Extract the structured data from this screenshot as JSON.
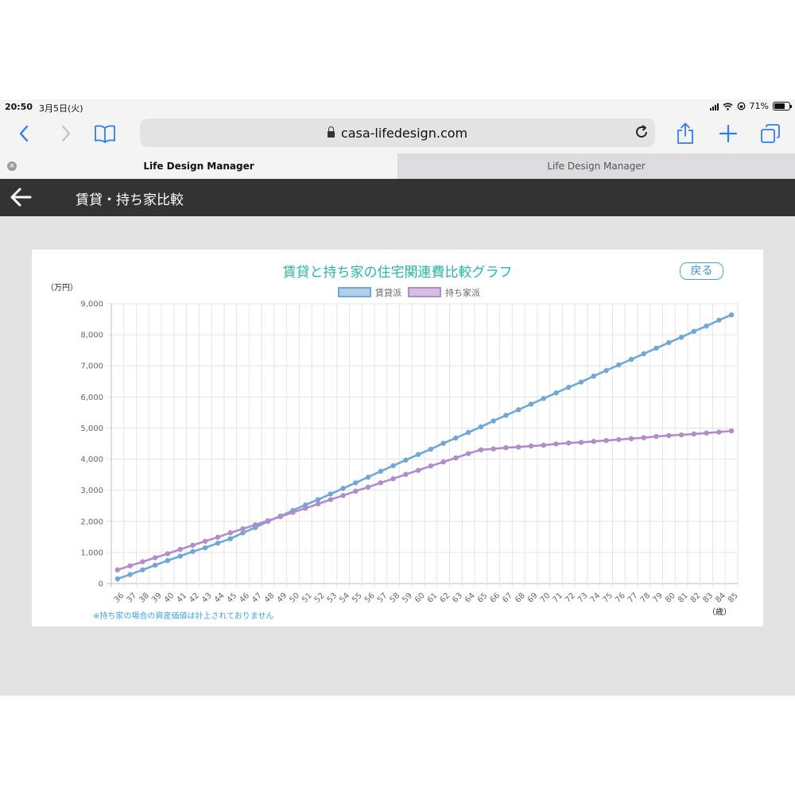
{
  "statusbar": {
    "time": "20:50",
    "date": "3月5日(火)",
    "battery": "71%",
    "battery_level": 0.71
  },
  "browser": {
    "url": "casa-lifedesign.com",
    "tabs": [
      {
        "label": "Life Design Manager"
      },
      {
        "label": "Life Design Manager"
      }
    ]
  },
  "appbar": {
    "title": "賃貸・持ち家比較"
  },
  "card": {
    "back_button": "戻る",
    "note": "※持ち家の場合の資産価値は計上されておりません",
    "y_unit": "（万円）",
    "x_unit": "（歳）"
  },
  "colors": {
    "rent": "#6fa8d6",
    "own": "#b08cc8",
    "title": "#26b6a8",
    "appbar": "#333333"
  },
  "chart_data": {
    "type": "line",
    "title": "賃貸と持ち家の住宅関連費比較グラフ",
    "xlabel": "（歳）",
    "ylabel": "（万円）",
    "ylim": [
      0,
      9000
    ],
    "grid": true,
    "legend": "top-center",
    "x": [
      "36",
      "37",
      "38",
      "39",
      "40",
      "41",
      "42",
      "43",
      "44",
      "45",
      "46",
      "47",
      "48",
      "49",
      "50",
      "51",
      "52",
      "53",
      "54",
      "55",
      "56",
      "57",
      "58",
      "59",
      "60",
      "61",
      "62",
      "63",
      "64",
      "65",
      "66",
      "67",
      "68",
      "69",
      "70",
      "71",
      "72",
      "73",
      "74",
      "75",
      "76",
      "77",
      "78",
      "79",
      "80",
      "81",
      "82",
      "83",
      "84",
      "85"
    ],
    "y_ticks": [
      "0",
      "1,000",
      "2,000",
      "3,000",
      "4,000",
      "5,000",
      "6,000",
      "7,000",
      "8,000",
      "9,000"
    ],
    "series": [
      {
        "name": "賃貸派",
        "color": "#6fa8d6",
        "values": [
          150,
          290,
          440,
          590,
          740,
          880,
          1030,
          1150,
          1300,
          1440,
          1630,
          1800,
          2000,
          2170,
          2350,
          2530,
          2700,
          2880,
          3060,
          3240,
          3420,
          3610,
          3790,
          3970,
          4150,
          4320,
          4510,
          4680,
          4860,
          5040,
          5230,
          5410,
          5590,
          5770,
          5950,
          6130,
          6310,
          6480,
          6670,
          6850,
          7030,
          7210,
          7390,
          7570,
          7750,
          7920,
          8110,
          8280,
          8470,
          8640
        ]
      },
      {
        "name": "持ち家派",
        "color": "#b08cc8",
        "values": [
          440,
          570,
          700,
          830,
          960,
          1100,
          1230,
          1360,
          1490,
          1630,
          1760,
          1890,
          2020,
          2150,
          2290,
          2420,
          2560,
          2700,
          2830,
          2970,
          3100,
          3240,
          3370,
          3510,
          3640,
          3780,
          3910,
          4040,
          4180,
          4300,
          4330,
          4370,
          4390,
          4420,
          4450,
          4490,
          4520,
          4540,
          4570,
          4600,
          4630,
          4660,
          4690,
          4730,
          4760,
          4780,
          4810,
          4840,
          4870,
          4910
        ]
      }
    ]
  }
}
